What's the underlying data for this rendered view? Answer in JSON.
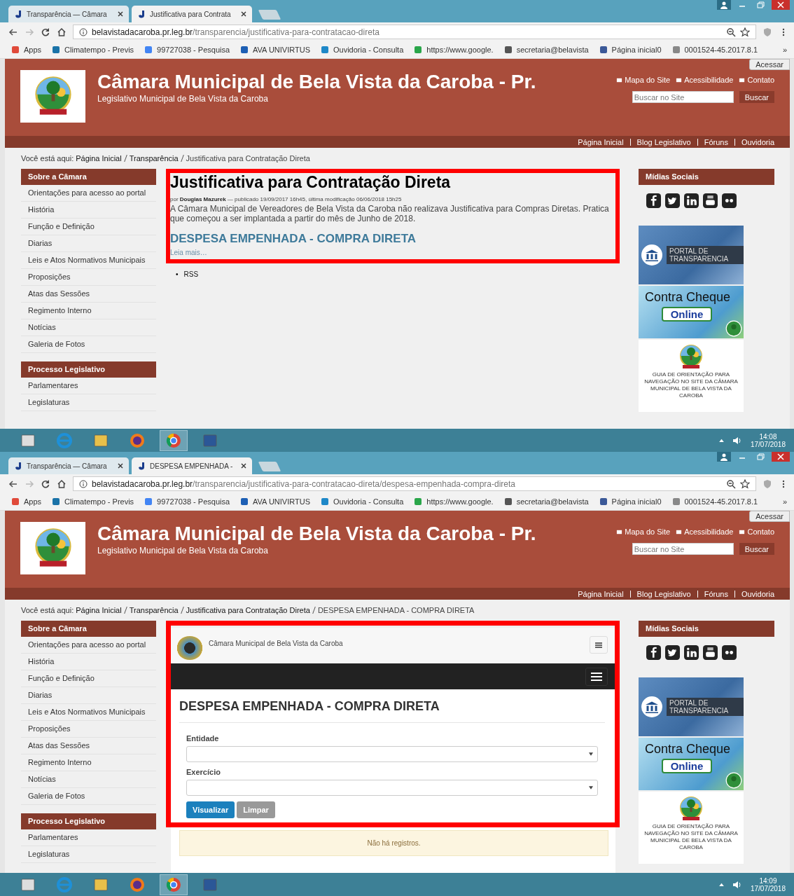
{
  "screens": [
    {
      "tabs": [
        {
          "title": "Transparência — Câmara",
          "selected": false
        },
        {
          "title": "Justificativa para Contrata",
          "selected": true
        }
      ],
      "address": {
        "host": "belavistadacaroba.pr.leg.br",
        "path": "/transparencia/justificativa-para-contratacao-direta"
      },
      "bookmarks": [
        "Apps",
        "Climatempo - Previs",
        "99727038 - Pesquisa",
        "AVA UNIVIRTUS",
        "Ouvidoria - Consulta",
        "https://www.google.",
        "secretaria@belavista",
        "Página inicial0",
        "0001524-45.2017.8.1"
      ],
      "more_bookmarks": "»",
      "site": {
        "login": "Acessar",
        "title": "Câmara Municipal de Bela Vista da Caroba - Pr.",
        "subtitle": "Legislativo Municipal de Bela Vista da Caroba",
        "links": [
          "Mapa do Site",
          "Acessibilidade",
          "Contato"
        ],
        "search": {
          "placeholder": "Buscar no Site",
          "button": "Buscar"
        },
        "nav": [
          "Página Inicial",
          "Blog Legislativo",
          "Fóruns",
          "Ouvidoria"
        ]
      },
      "breadcrumb": {
        "label": "Você está aqui:",
        "links": [
          "Página Inicial",
          "Transparência"
        ],
        "current": "Justificativa para Contratação Direta"
      },
      "sidebar": [
        {
          "title": "Sobre a Câmara",
          "items": [
            "Orientações para acesso ao portal",
            "História",
            "Função e Definição",
            "Diarias",
            "Leis e Atos Normativos Municipais",
            "Proposições",
            "Atas das Sessões",
            "Regimento Interno",
            "Notícias",
            "Galeria de Fotos"
          ]
        },
        {
          "title": "Processo Legislativo",
          "items": [
            "Parlamentares",
            "Legislaturas"
          ]
        }
      ],
      "main": {
        "kind": "article",
        "highlighted": true,
        "title": "Justificativa para Contratação Direta",
        "byline": "por **Douglas Mazurek** — publicado 19/09/2017 16h45, última modificação 06/06/2018 15h25",
        "body": "A Câmara Municipal de Vereadores de Bela Vista da Caroba não realizava Justificativa para Compras Diretas. Pratica que começou a ser implantada a partir do mês de Junho de 2018.",
        "link": "DESPESA EMPENHADA - COMPRA DIRETA",
        "more": "Leia mais…",
        "list": [
          {
            "marker": "•",
            "text": "RSS"
          }
        ]
      },
      "aside": {
        "title": "Mídias Sociais",
        "portal": [
          "PORTAL DE",
          "TRANSPARENCIA"
        ],
        "cheque": {
          "title": "Contra Cheque",
          "button": "Online"
        },
        "guide": "GUIA DE ORIENTAÇÃO PARA NAVEGAÇÃO NO SITE DA CÂMARA MUNICIPAL DE BELA VISTA DA CAROBA"
      },
      "taskbar": {
        "time": "14:08",
        "date": "17/07/2018"
      }
    },
    {
      "tabs": [
        {
          "title": "Transparência — Câmara",
          "selected": false
        },
        {
          "title": "DESPESA EMPENHADA -",
          "selected": true
        }
      ],
      "address": {
        "host": "belavistadacaroba.pr.leg.br",
        "path": "/transparencia/justificativa-para-contratacao-direta/despesa-empenhada-compra-direta"
      },
      "bookmarks": [
        "Apps",
        "Climatempo - Previs",
        "99727038 - Pesquisa",
        "AVA UNIVIRTUS",
        "Ouvidoria - Consulta",
        "https://www.google.",
        "secretaria@belavista",
        "Página inicial0",
        "0001524-45.2017.8.1"
      ],
      "more_bookmarks": "»",
      "site": {
        "login": "Acessar",
        "title": "Câmara Municipal de Bela Vista da Caroba - Pr.",
        "subtitle": "Legislativo Municipal de Bela Vista da Caroba",
        "links": [
          "Mapa do Site",
          "Acessibilidade",
          "Contato"
        ],
        "search": {
          "placeholder": "Buscar no Site",
          "button": "Buscar"
        },
        "nav": [
          "Página Inicial",
          "Blog Legislativo",
          "Fóruns",
          "Ouvidoria"
        ]
      },
      "breadcrumb": {
        "label": "Você está aqui:",
        "links": [
          "Página Inicial",
          "Transparência",
          "Justificativa para Contratação Direta"
        ],
        "current": "DESPESA EMPENHADA - COMPRA DIRETA"
      },
      "sidebar": [
        {
          "title": "Sobre a Câmara",
          "items": [
            "Orientações para acesso ao portal",
            "História",
            "Função e Definição",
            "Diarias",
            "Leis e Atos Normativos Municipais",
            "Proposições",
            "Atas das Sessões",
            "Regimento Interno",
            "Notícias",
            "Galeria de Fotos"
          ]
        },
        {
          "title": "Processo Legislativo",
          "items": [
            "Parlamentares",
            "Legislaturas"
          ]
        }
      ],
      "main": {
        "kind": "embed",
        "highlighted": true,
        "brand": "Câmara Municipal de Bela Vista da Caroba",
        "heading": "DESPESA EMPENHADA - COMPRA DIRETA",
        "fields": [
          {
            "label": "Entidade"
          },
          {
            "label": "Exercício"
          }
        ],
        "buttons": [
          {
            "label": "Visualizar",
            "primary": true
          },
          {
            "label": "Limpar",
            "primary": false
          }
        ],
        "notice": "Não há registros."
      },
      "aside": {
        "title": "Mídias Sociais",
        "portal": [
          "PORTAL DE",
          "TRANSPARENCIA"
        ],
        "cheque": {
          "title": "Contra Cheque",
          "button": "Online"
        },
        "guide": "GUIA DE ORIENTAÇÃO PARA NAVEGAÇÃO NO SITE DA CÂMARA MUNICIPAL DE BELA VISTA DA CAROBA"
      },
      "taskbar": {
        "time": "14:09",
        "date": "17/07/2018"
      }
    }
  ]
}
